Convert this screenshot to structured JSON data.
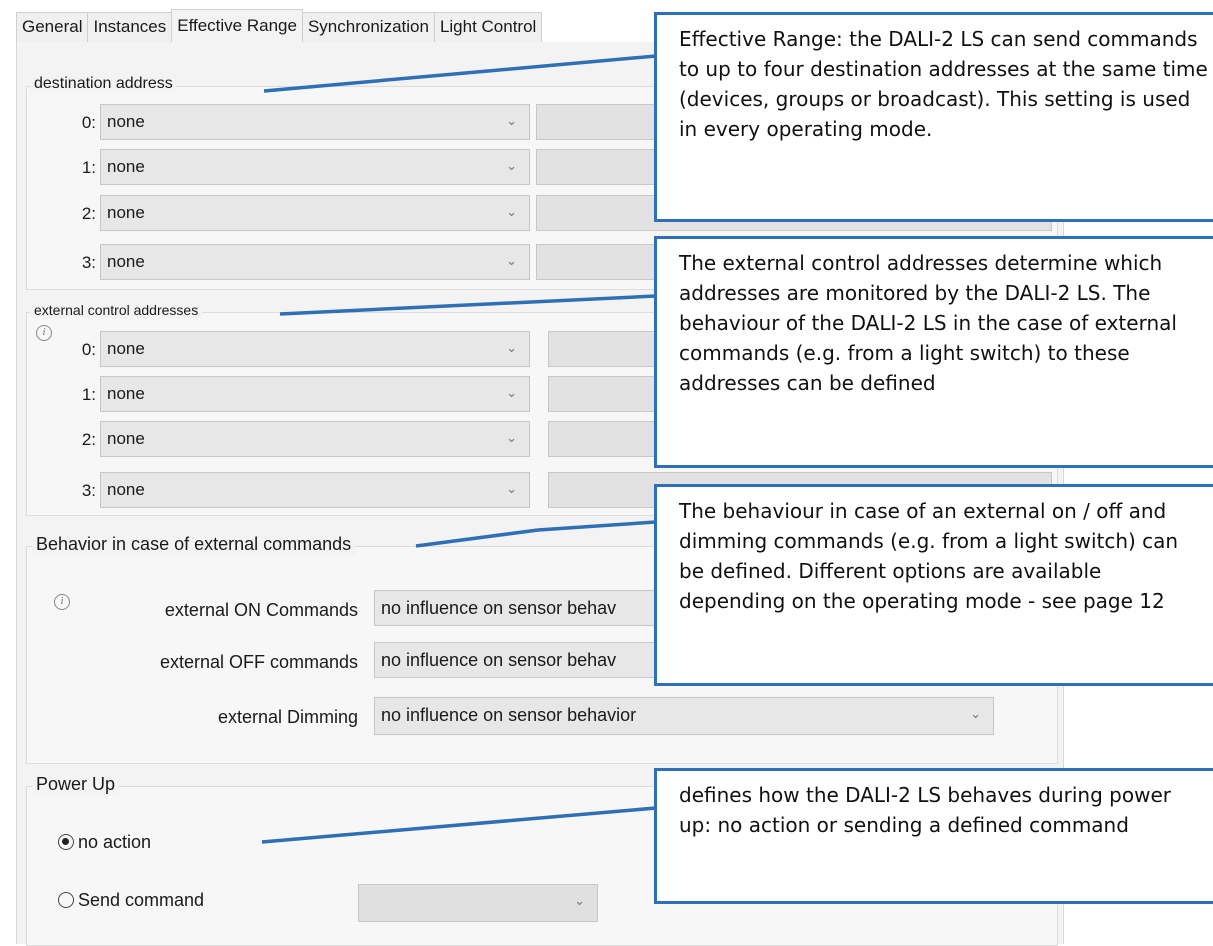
{
  "tabs": [
    "General",
    "Instances",
    "Effective Range",
    "Synchronization",
    "Light Control"
  ],
  "destination": {
    "title": "destination address",
    "rows": [
      {
        "index": "0:",
        "value": "none"
      },
      {
        "index": "1:",
        "value": "none"
      },
      {
        "index": "2:",
        "value": "none"
      },
      {
        "index": "3:",
        "value": "none"
      }
    ]
  },
  "external_control": {
    "title": "external control addresses",
    "rows": [
      {
        "index": "0:",
        "value": "none"
      },
      {
        "index": "1:",
        "value": "none"
      },
      {
        "index": "2:",
        "value": "none"
      },
      {
        "index": "3:",
        "value": "none"
      }
    ]
  },
  "behavior": {
    "title": "Behavior in case of external commands",
    "on_label": "external ON Commands",
    "on_value": "no influence on sensor behav",
    "off_label": "external OFF commands",
    "off_value": "no influence on sensor behav",
    "dim_label": "external Dimming",
    "dim_value": "no influence on sensor behavior"
  },
  "power_up": {
    "title": "Power Up",
    "option_no_action": "no action",
    "option_send": "Send command"
  },
  "callouts": {
    "effective_range": "Effective Range: the DALI-2 LS can send commands to up to four destination addresses at the same time (devices, groups or broadcast). This setting is used in every operating mode.",
    "external_control": "The external control addresses determine which addresses are monitored by the DALI-2 LS. The behaviour of the DALI-2 LS in the case of external commands (e.g. from a light switch) to these addresses can be defined",
    "behaviour": "The behaviour in case of an external on / off and dimming commands (e.g. from a light switch) can be defined. Different options are available depending on the operating mode - see page 12",
    "power_up": "defines how the DALI-2 LS behaves during power up: no action or sending a defined command"
  },
  "colors": {
    "callout_border": "#2e6fb6",
    "panel_bg": "#f3f3f3",
    "combo_bg": "#e7e7e7"
  }
}
